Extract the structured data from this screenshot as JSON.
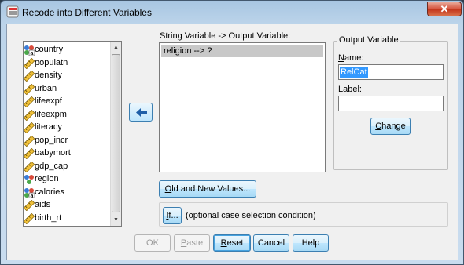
{
  "window": {
    "title": "Recode into Different Variables",
    "close_glyph": "✕"
  },
  "variables": [
    {
      "name": "country",
      "icon": "nominal-string-icon"
    },
    {
      "name": "populatn",
      "icon": "scale-ruler-icon"
    },
    {
      "name": "density",
      "icon": "scale-ruler-icon"
    },
    {
      "name": "urban",
      "icon": "scale-ruler-icon"
    },
    {
      "name": "lifeexpf",
      "icon": "scale-ruler-icon"
    },
    {
      "name": "lifeexpm",
      "icon": "scale-ruler-icon"
    },
    {
      "name": "literacy",
      "icon": "scale-ruler-icon"
    },
    {
      "name": "pop_incr",
      "icon": "scale-ruler-icon"
    },
    {
      "name": "babymort",
      "icon": "scale-ruler-icon"
    },
    {
      "name": "gdp_cap",
      "icon": "scale-ruler-icon"
    },
    {
      "name": "region",
      "icon": "nominal-icon"
    },
    {
      "name": "calories",
      "icon": "nominal-string-icon"
    },
    {
      "name": "aids",
      "icon": "scale-ruler-icon"
    },
    {
      "name": "birth_rt",
      "icon": "scale-ruler-icon"
    }
  ],
  "mapping": {
    "header": "String Variable -> Output Variable:",
    "rows": [
      "religion --> ?"
    ]
  },
  "output_variable": {
    "group_title": "Output Variable",
    "name_label": "Name:",
    "name_value": "RelCat",
    "label_label": "Label:",
    "label_value": "",
    "change_button": "Change"
  },
  "old_new_button": "Old and New Values...",
  "if_button": "If...",
  "if_description": "(optional case selection condition)",
  "buttons": {
    "ok": "OK",
    "paste": "Paste",
    "reset": "Reset",
    "cancel": "Cancel",
    "help": "Help"
  },
  "colors": {
    "selection": "#3399ff",
    "list_row_selected": "#c8c8c8",
    "close_button": "#c2331a"
  }
}
